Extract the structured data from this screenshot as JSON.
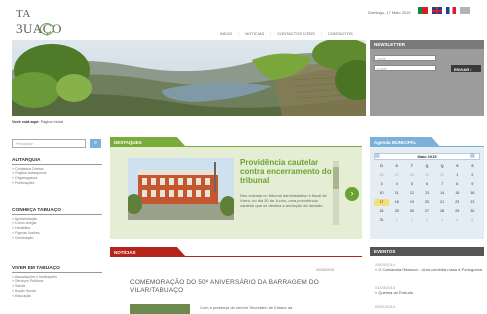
{
  "logo": {
    "line1": "TA",
    "line2": "3UAÇO"
  },
  "header": {
    "date": "Domingo, 17 Maio 2015",
    "nav": [
      "INÍCIO",
      "NOTÍCIAS",
      "CONTACTOS ÚTEIS",
      "CONTACTOS"
    ],
    "flags": [
      "flag-pt-icon",
      "flag-uk-icon",
      "flag-fr-icon",
      "flag-other-icon"
    ]
  },
  "newsletter": {
    "title": "NEWSLETTER",
    "name_placeholder": "nome",
    "email_placeholder": "e-mail",
    "button": "ENVIAR"
  },
  "breadcrumb": {
    "prefix": "Você está aqui:",
    "page": "Página Inicial"
  },
  "search": {
    "placeholder": "Pesquisar"
  },
  "sidebar": [
    {
      "title": "AUTARQUIA",
      "items": [
        "Contactos Diretos",
        "Órgãos Autárquicos",
        "Organograma",
        "Publicações"
      ]
    },
    {
      "title": "CONHEÇA TABUAÇO",
      "items": [
        "Apresentação",
        "Como chegar",
        "Heráldica",
        "Figuras Ilustres",
        "Geminação"
      ]
    },
    {
      "title": "VIVER EM TABUAÇO",
      "items": [
        "Associações e Instituições",
        "Serviços Públicos",
        "Saúde",
        "Acção Social",
        "Educação"
      ]
    }
  ],
  "featured": {
    "tab": "DESTAQUES",
    "title": "Providência cautelar contra encerramento do tribunal",
    "body": "Deu entrada no tribunal administrativo e fiscal de Viseu, no dia 30 de Junho, uma providência cautelar que se destina a anulação da decisão"
  },
  "news": {
    "tab": "NOTÍCIAS",
    "date": "30/08/2015",
    "title": "COMEMORAÇÃO DO 50º ANIVERSÁRIO DA BARRAGEM DO VILAR/TABUAÇO",
    "body": "Com a presença do senhor Secretário de Estado da"
  },
  "agenda": {
    "tab": "Agenda MUNICIPAL",
    "month": "Maio 2015",
    "weekdays": [
      "D",
      "S",
      "T",
      "Q",
      "Q",
      "S",
      "S"
    ],
    "days": [
      [
        "26",
        "27",
        "28",
        "29",
        "30",
        "1",
        "2"
      ],
      [
        "3",
        "4",
        "5",
        "6",
        "7",
        "8",
        "9"
      ],
      [
        "10",
        "11",
        "12",
        "13",
        "14",
        "15",
        "16"
      ],
      [
        "17",
        "18",
        "19",
        "20",
        "21",
        "22",
        "23"
      ],
      [
        "24",
        "25",
        "26",
        "27",
        "28",
        "29",
        "30"
      ],
      [
        "31",
        "1",
        "2",
        "3",
        "4",
        "5",
        "6"
      ]
    ],
    "today": "17"
  },
  "events": {
    "title": "EVENTOS",
    "items": [
      {
        "date": "29/03/2014",
        "text": "» O Camarada Hitasson - Uma comédia russa à Portuguesa"
      },
      {
        "date": "01/03/2014",
        "text": "» Queima do Entrudo"
      },
      {
        "date": "09/01/2014",
        "text": ""
      }
    ]
  },
  "colors": {
    "green": "#7aac3c",
    "red": "#b7221a",
    "blue": "#7bb0da"
  }
}
